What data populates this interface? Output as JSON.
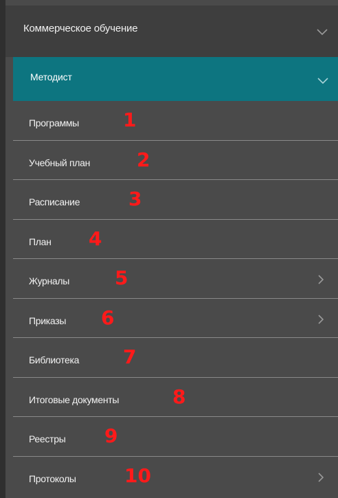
{
  "menu": {
    "header": {
      "label": "Коммерческое обучение",
      "icon": "chevron-down-icon"
    },
    "sub_header": {
      "label": "Методист",
      "icon": "chevron-down-icon",
      "color": "#0d7580"
    },
    "items": [
      {
        "label": "Программы",
        "number": "1",
        "has_submenu": false
      },
      {
        "label": "Учебный план",
        "number": "2",
        "has_submenu": false
      },
      {
        "label": "Расписание",
        "number": "3",
        "has_submenu": false
      },
      {
        "label": "План",
        "number": "4",
        "has_submenu": false
      },
      {
        "label": "Журналы",
        "number": "5",
        "has_submenu": true
      },
      {
        "label": "Приказы",
        "number": "6",
        "has_submenu": true
      },
      {
        "label": "Библиотека",
        "number": "7",
        "has_submenu": false
      },
      {
        "label": "Итоговые документы",
        "number": "8",
        "has_submenu": false
      },
      {
        "label": "Реестры",
        "number": "9",
        "has_submenu": false
      },
      {
        "label": "Протоколы",
        "number": "10",
        "has_submenu": true
      }
    ],
    "annotation_color": "#ff1a1a"
  }
}
